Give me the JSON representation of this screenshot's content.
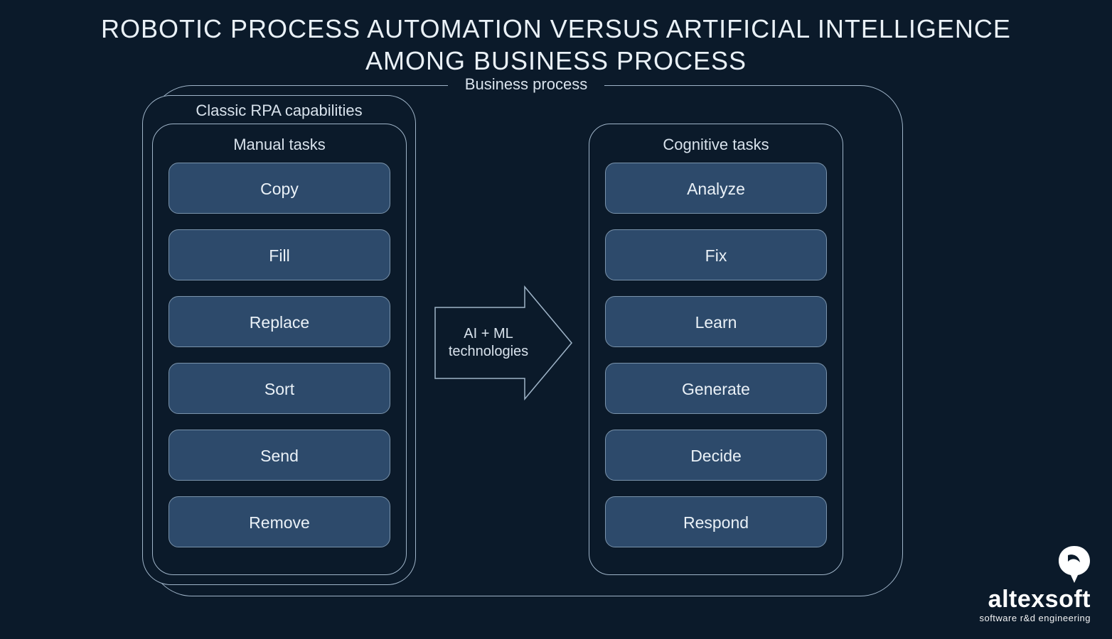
{
  "title": "ROBOTIC PROCESS AUTOMATION VERSUS ARTIFICIAL INTELLIGENCE AMONG BUSINESS PROCESS",
  "outer_label": "Business process",
  "rpa_label": "Classic RPA capabilities",
  "manual": {
    "title": "Manual tasks",
    "items": [
      "Copy",
      "Fill",
      "Replace",
      "Sort",
      "Send",
      "Remove"
    ]
  },
  "cognitive": {
    "title": "Cognitive tasks",
    "items": [
      "Analyze",
      "Fix",
      "Learn",
      "Generate",
      "Decide",
      "Respond"
    ]
  },
  "arrow_label": "AI + ML technologies",
  "logo": {
    "brand": "altexsoft",
    "tagline": "software r&d engineering"
  },
  "colors": {
    "background": "#0b1a2a",
    "stroke": "#9fb4c8",
    "pill_fill": "#2d4a6b",
    "pill_stroke": "#7a93ab",
    "text": "#d8e2ec"
  }
}
